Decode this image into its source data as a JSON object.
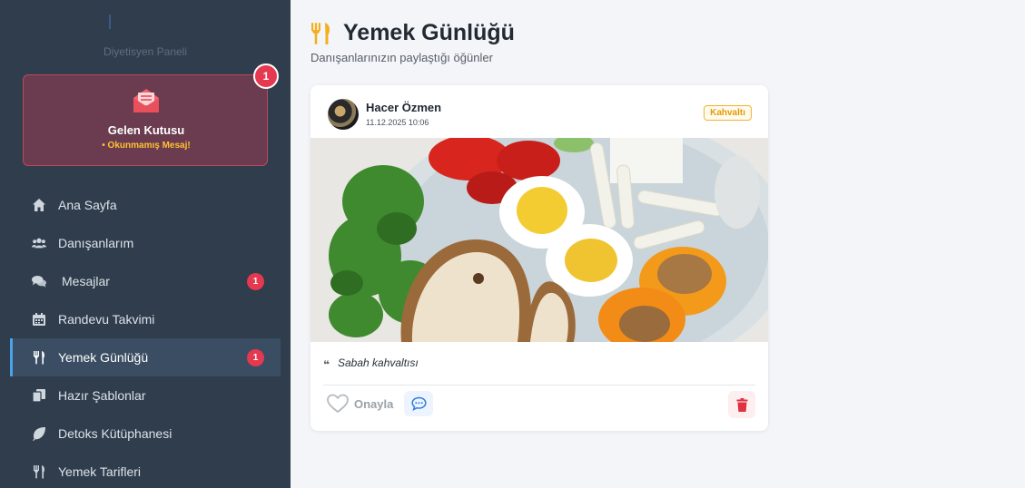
{
  "sidebar": {
    "subtitle": "Diyetisyen Paneli",
    "inbox": {
      "title": "Gelen Kutusu",
      "subtitle": "• Okunmamış Mesaj!",
      "badge": "1",
      "icon": "envelope-open-icon"
    },
    "items": [
      {
        "label": "Ana Sayfa",
        "icon": "home-icon",
        "active": false,
        "badge": null
      },
      {
        "label": "Danışanlarım",
        "icon": "users-icon",
        "active": false,
        "badge": null
      },
      {
        "label": "Mesajlar",
        "icon": "comments-icon",
        "active": false,
        "badge": "1"
      },
      {
        "label": "Randevu Takvimi",
        "icon": "calendar-icon",
        "active": false,
        "badge": null
      },
      {
        "label": "Yemek Günlüğü",
        "icon": "utensils-icon",
        "active": true,
        "badge": "1"
      },
      {
        "label": "Hazır Şablonlar",
        "icon": "copy-icon",
        "active": false,
        "badge": null
      },
      {
        "label": "Detoks Kütüphanesi",
        "icon": "leaf-icon",
        "active": false,
        "badge": null
      },
      {
        "label": "Yemek Tarifleri",
        "icon": "utensils-icon",
        "active": false,
        "badge": null
      }
    ]
  },
  "main": {
    "title": "Yemek Günlüğü",
    "title_icon": "utensils-icon",
    "subtitle": "Danışanlarınızın paylaştığı öğünler"
  },
  "post": {
    "user_name": "Hacer Özmen",
    "date": "11.12.2025 10:06",
    "meal_type": "Kahvaltı",
    "caption_mark": "❝",
    "caption": "Sabah kahvaltısı",
    "like_label": "Onayla"
  },
  "colors": {
    "sidebar_bg": "#2f3d4c",
    "accent": "#4aa3e8",
    "badge": "#e53950",
    "inbox_bg": "#6b3c4f",
    "warning": "#ffc233"
  }
}
